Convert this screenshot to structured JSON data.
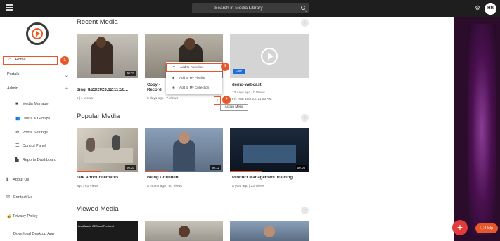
{
  "topbar": {
    "search_placeholder": "Search in Media Library",
    "avatar_initials": "HR"
  },
  "sidebar": {
    "items": [
      {
        "label": "Home",
        "icon": "home-icon",
        "highlighted": true
      },
      {
        "label": "Portals",
        "icon": "",
        "expandable": true
      },
      {
        "label": "Admin",
        "icon": "",
        "expandable": true,
        "expanded": true
      },
      {
        "label": "Media Manager",
        "icon": "folder-icon"
      },
      {
        "label": "Users & Groups",
        "icon": "users-icon"
      },
      {
        "label": "Portal Settings",
        "icon": "gear-icon"
      },
      {
        "label": "Control Panel",
        "icon": "list-icon"
      },
      {
        "label": "Reports Dashboard",
        "icon": "chart-icon"
      },
      {
        "label": "About Us",
        "icon": "info-icon"
      },
      {
        "label": "Contact Us",
        "icon": "envelope-icon"
      },
      {
        "label": "Privacy Policy",
        "icon": "lock-icon"
      },
      {
        "label": "Download Desktop App",
        "icon": ""
      }
    ],
    "badge_home": "1"
  },
  "sections": {
    "recent": {
      "title": "Recent Media",
      "cards": [
        {
          "title": "ding_8/23/2023,12:11:56...",
          "meta": "s | 1 Views",
          "duration": "00:20"
        },
        {
          "title": "Copy -",
          "title2": "Recordi",
          "meta": "5 days ago | 7 Views",
          "duration": ""
        },
        {
          "title": "demo-webcast",
          "meta1": "12 days ago | 0 Views",
          "meta2": "Fri. Aug 18th 23, 11:53 AM",
          "live": "Live"
        }
      ]
    },
    "popular": {
      "title": "Popular Media",
      "cards": [
        {
          "title": "rate Announcements",
          "meta": "ago | 61 Views",
          "duration": "00:20"
        },
        {
          "title": "Being Confident",
          "meta": "a month ago | 60 Views",
          "duration": "00:12"
        },
        {
          "title": "Product Management Training",
          "meta": "a year ago | 23 Views",
          "duration": "00:05"
        }
      ]
    },
    "viewed": {
      "title": "Viewed Media",
      "first_caption": "heed Martin CEO and President"
    }
  },
  "action_menu": {
    "items": [
      {
        "label": "Add to Favorites",
        "icon": "heart-icon"
      },
      {
        "label": "Add to My Playlist",
        "icon": "folder-icon"
      },
      {
        "label": "Add to My Collection",
        "icon": "layers-icon"
      }
    ],
    "tooltip": "Action Menu",
    "badge_favorites": "3",
    "badge_kebab": "2"
  },
  "fab_label": "+",
  "help_label": "Help",
  "colors": {
    "accent": "#e8572a",
    "topbar": "#1e1e1e",
    "live": "#1e6fd9"
  }
}
